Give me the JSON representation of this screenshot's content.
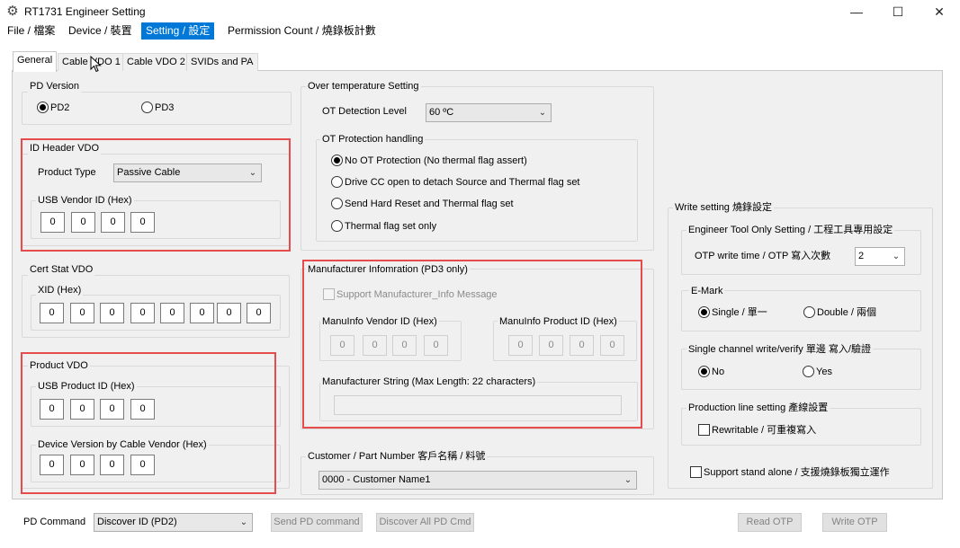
{
  "window": {
    "title": "RT1731 Engineer Setting",
    "minimize": "—",
    "maximize": "☐",
    "close": "✕",
    "app_icon": "⚙"
  },
  "menu": [
    "File / 檔案",
    "Device / 裝置",
    "Setting / 設定",
    "Permission Count / 燒錄板計數"
  ],
  "tabs": [
    "General",
    "Cable VDO 1",
    "Cable VDO 2",
    "SVIDs and PA"
  ],
  "pd_version": {
    "title": "PD Version",
    "options": [
      "PD2",
      "PD3"
    ],
    "selected": "PD2"
  },
  "id_header": {
    "title": "ID Header VDO",
    "product_type_label": "Product Type",
    "product_type_value": "Passive Cable",
    "usb_vendor_title": "USB Vendor ID (Hex)",
    "usb_vendor_values": [
      "0",
      "0",
      "0",
      "0"
    ]
  },
  "cert_stat": {
    "title": "Cert Stat VDO",
    "xid_title": "XID (Hex)",
    "xid_values": [
      "0",
      "0",
      "0",
      "0",
      "0",
      "0",
      "0",
      "0"
    ]
  },
  "product_vdo": {
    "title": "Product VDO",
    "usb_product_title": "USB Product ID (Hex)",
    "usb_product_values": [
      "0",
      "0",
      "0",
      "0"
    ],
    "device_version_title": "Device Version by Cable Vendor (Hex)",
    "device_version_values": [
      "0",
      "0",
      "0",
      "0"
    ]
  },
  "over_temp": {
    "title": "Over temperature Setting",
    "detection_label": "OT Detection Level",
    "detection_value": "60 ºC",
    "protection_title": "OT Protection handling",
    "options": [
      "No OT Protection (No thermal flag assert)",
      "Drive CC open to detach Source and Thermal flag set",
      "Send Hard Reset and Thermal flag set",
      "Thermal flag set only"
    ],
    "selected_index": 0
  },
  "manufacturer": {
    "title": "Manufacturer Infomration (PD3 only)",
    "support_label": "Support Manufacturer_Info Message",
    "vendor_title": "ManuInfo Vendor ID (Hex)",
    "vendor_values": [
      "0",
      "0",
      "0",
      "0"
    ],
    "product_title": "ManuInfo Product ID (Hex)",
    "product_values": [
      "0",
      "0",
      "0",
      "0"
    ],
    "string_title": "Manufacturer String (Max Length: 22 characters)",
    "string_value": ""
  },
  "customer": {
    "title": "Customer / Part Number  客戶名稱 / 料號",
    "value": "0000 - Customer Name1"
  },
  "write_setting": {
    "title": "Write setting 燒錄設定",
    "engineer_title": "Engineer Tool Only Setting / 工程工具專用設定",
    "otp_label": "OTP write time / OTP 寫入次數",
    "otp_value": "2",
    "emark_title": "E-Mark",
    "emark_options": [
      "Single / 單一",
      "Double / 兩個"
    ],
    "emark_selected": "Single / 單一",
    "single_channel_title": "Single channel write/verify 單邊 寫入/驗證",
    "single_channel_options": [
      "No",
      "Yes"
    ],
    "single_channel_selected": "No",
    "production_title": "Production line setting  產線設置",
    "rewritable_label": "Rewritable / 可重複寫入",
    "standalone_label": "Support stand alone / 支援燒錄板獨立運作"
  },
  "bottom": {
    "pd_command_label": "PD Command",
    "pd_command_value": "Discover ID (PD2)",
    "send_pd": "Send PD command",
    "discover_all": "Discover All PD Cmd",
    "read_otp": "Read OTP",
    "write_otp": "Write OTP"
  },
  "colors": {
    "highlight_red": "#e74c4c",
    "menu_active": "#0078d7",
    "panel_bg": "#f0f0f0"
  }
}
